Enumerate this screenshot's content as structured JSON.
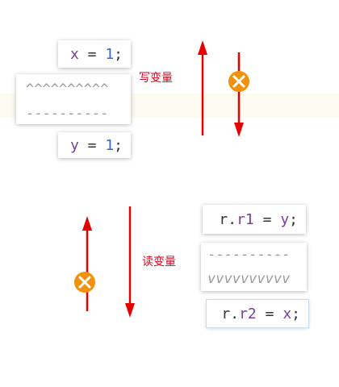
{
  "write_section": {
    "label": "写变量",
    "first_statement": {
      "var": "x",
      "op": "=",
      "value": "1",
      "end": ";"
    },
    "caret_marks": "^^^^^^^^^^",
    "dash_marks": "----------",
    "second_statement": {
      "var": "y",
      "op": "=",
      "value": "1",
      "end": ";"
    }
  },
  "read_section": {
    "label": "读变量",
    "first_statement": {
      "obj": "r",
      "dot": ".",
      "field": "r1",
      "op": "=",
      "value": "y",
      "end": ";"
    },
    "dash_marks": "----------",
    "vee_marks": "vvvvvvvvvv",
    "second_statement": {
      "obj": "r",
      "dot": ".",
      "field": "r2",
      "op": "=",
      "value": "x",
      "end": ";"
    }
  },
  "colors": {
    "arrow": "#e60000",
    "forbidden_badge": "#f0920e",
    "label": "#d9001b",
    "highlight": "#fdfaf1"
  },
  "icons": {
    "forbidden": "close-icon"
  }
}
